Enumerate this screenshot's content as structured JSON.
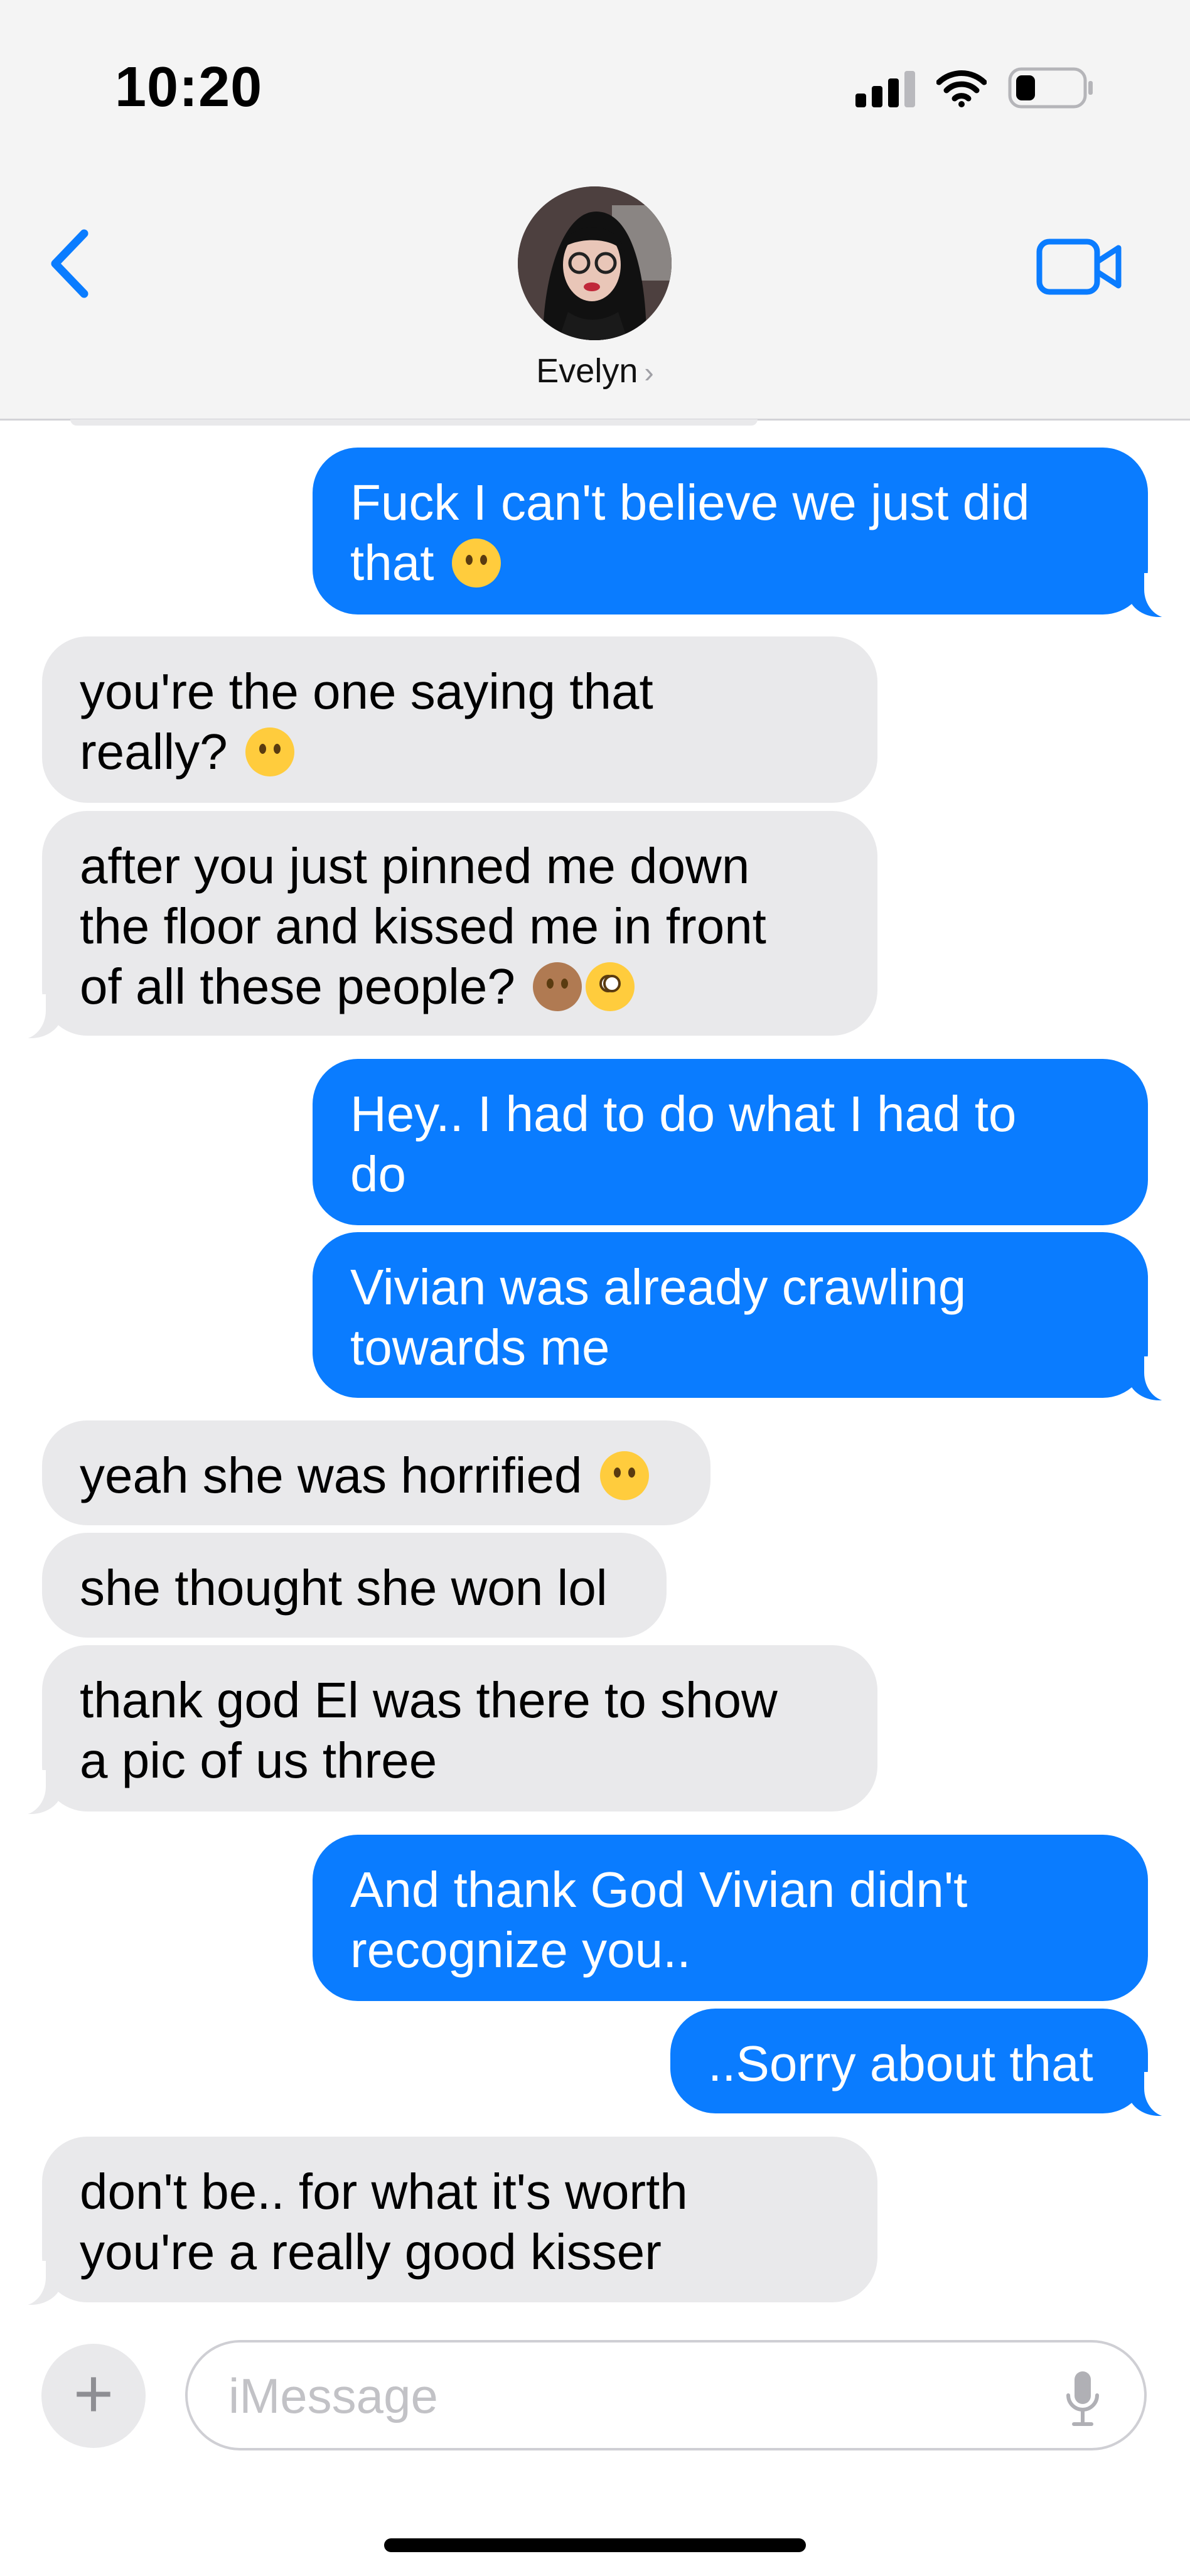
{
  "status_bar": {
    "time": "10:20"
  },
  "header": {
    "contact_name": "Evelyn",
    "chevron": "›"
  },
  "messages": [
    {
      "from": "me",
      "text": "Fuck I can't believe we just did",
      "text2": "that",
      "emoji": "face-exhaling"
    },
    {
      "from": "them",
      "text": "you're the one saying that",
      "text2": "really?",
      "emoji": "face-without-mouth"
    },
    {
      "from": "them",
      "text": "after you just pinned me down",
      "text2": "the floor and kissed me in front",
      "text3": "of all these people?",
      "emoji": "see-no-evil-monkey",
      "emoji2": "flushed-face"
    },
    {
      "from": "me",
      "text": "Hey.. I had to do what I had to",
      "text2": "do"
    },
    {
      "from": "me",
      "text": "Vivian was already crawling",
      "text2": "towards me"
    },
    {
      "from": "them",
      "text": "yeah she was horrified",
      "emoji": "face-with-hand-over-mouth"
    },
    {
      "from": "them",
      "text": "she thought she won lol"
    },
    {
      "from": "them",
      "text": "thank god El was there to show",
      "text2": "a pic of us three"
    },
    {
      "from": "me",
      "text": "And thank God Vivian didn't",
      "text2": "recognize you.."
    },
    {
      "from": "me",
      "text": "..Sorry about that"
    },
    {
      "from": "them",
      "text": "don't be.. for what it's worth",
      "text2": "you're a really good kisser"
    }
  ],
  "composer": {
    "plus": "+",
    "placeholder": "iMessage"
  },
  "colors": {
    "sent_bubble": "#0a7cff",
    "received_bubble": "#e9e9eb",
    "accent": "#0a7cff"
  }
}
